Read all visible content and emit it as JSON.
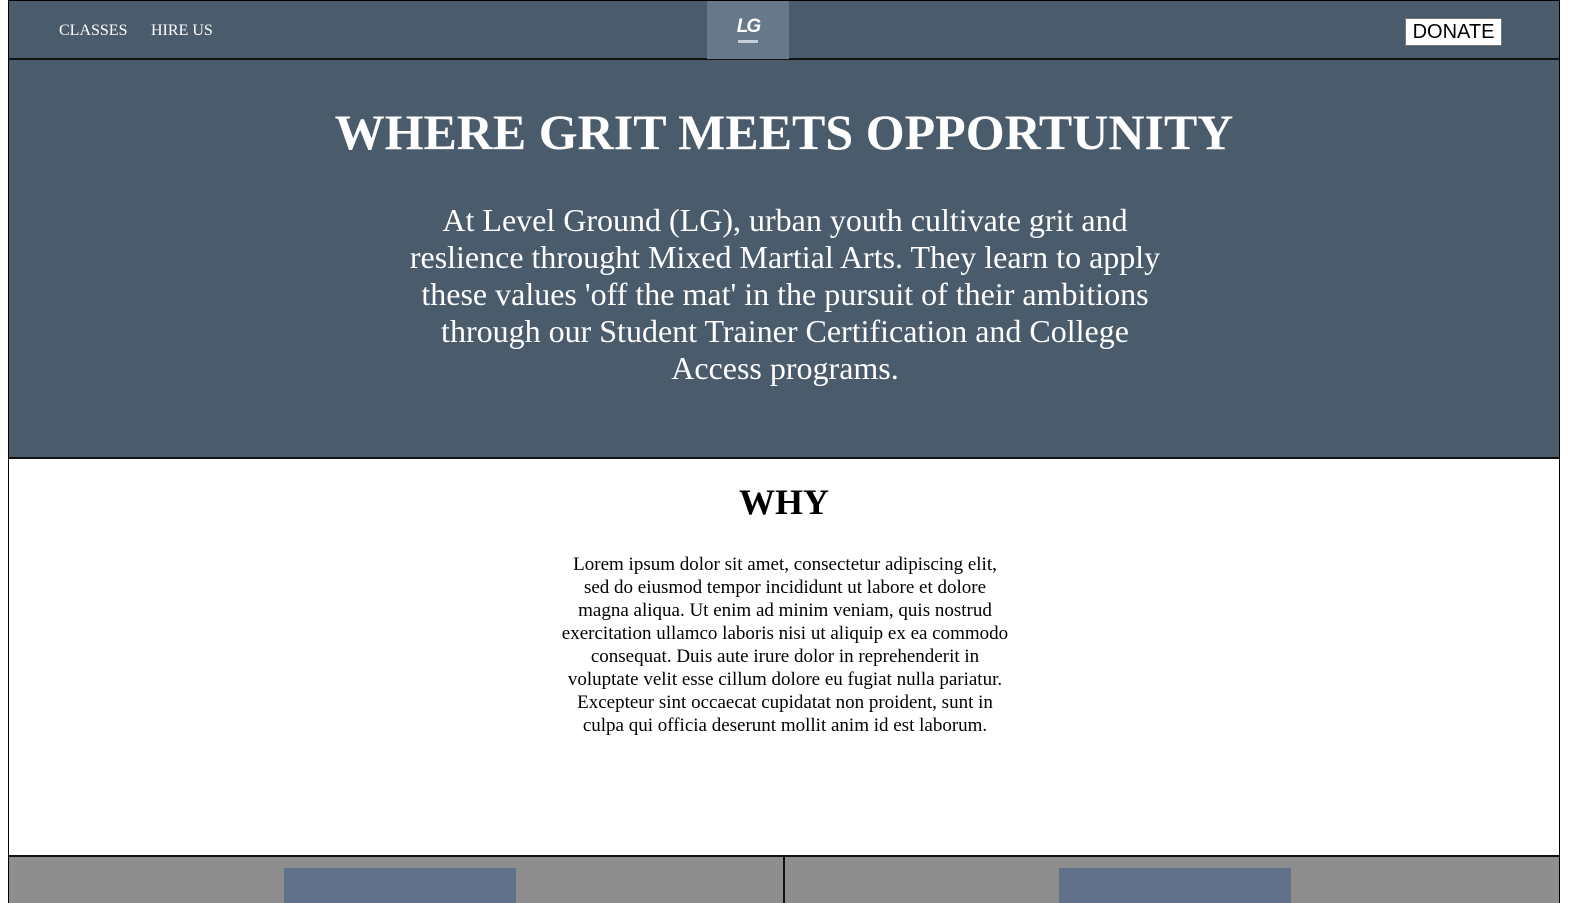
{
  "nav": {
    "links": [
      "CLASSES",
      "HIRE US"
    ],
    "logo_text": "LG",
    "donate_label": "DONATE"
  },
  "hero": {
    "title": "WHERE GRIT MEETS OPPORTUNITY",
    "text": "At Level Ground (LG), urban youth cultivate grit and reslience throught Mixed Martial Arts. They learn to apply these values 'off the mat' in the pursuit of their ambitions through our Student Trainer Certification and College Access programs."
  },
  "why": {
    "heading": "WHY",
    "text": "Lorem ipsum dolor sit amet, consectetur adipiscing elit, sed do eiusmod tempor incididunt ut labore et dolore magna aliqua. Ut enim ad minim veniam, quis nostrud exercitation ullamco laboris nisi ut aliquip ex ea commodo consequat. Duis aute irure dolor in reprehenderit in voluptate velit esse cillum dolore eu fugiat nulla pariatur. Excepteur sint occaecat cupidatat non proident, sunt in culpa qui officia deserunt mollit anim id est laborum."
  },
  "colors": {
    "header_bg": "#4a5b6c",
    "logo_bg": "#67788a",
    "card_bg": "#8e8e8e",
    "card_image": "#62728a"
  }
}
